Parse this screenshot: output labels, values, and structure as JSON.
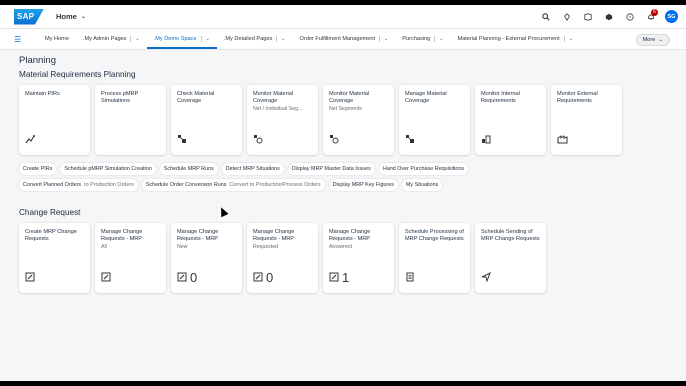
{
  "shell": {
    "logo": "SAP",
    "home_label": "Home",
    "notification_count": "6",
    "user_initials": "SG"
  },
  "tabs": [
    {
      "label": "My Home",
      "active": false
    },
    {
      "label": ".My Admin Pages",
      "active": false
    },
    {
      "label": ".My Demo Space",
      "active": true
    },
    {
      "label": ".My Detailed Pages",
      "active": false
    },
    {
      "label": "Order Fulfillment Management",
      "active": false
    },
    {
      "label": "Purchasing",
      "active": false
    },
    {
      "label": "Material Planning - External Procurement",
      "active": false
    }
  ],
  "more_label": "More",
  "page_title": "Planning",
  "mrp": {
    "title": "Material Requirements Planning",
    "tiles": [
      {
        "title": "Maintain PIRs",
        "sub": "",
        "icon": "chart-icon"
      },
      {
        "title": "Process pMRP Simulations",
        "sub": "",
        "icon": ""
      },
      {
        "title": "Check Material Coverage",
        "sub": "",
        "icon": "coverage-icon"
      },
      {
        "title": "Monitor Material Coverage",
        "sub": "Net / Individual Seg...",
        "icon": "monitor-icon"
      },
      {
        "title": "Monitor Material Coverage",
        "sub": "Net Segments",
        "icon": "monitor-icon"
      },
      {
        "title": "Manage Material Coverage",
        "sub": "",
        "icon": "coverage-icon"
      },
      {
        "title": "Monitor Internal Requirements",
        "sub": "",
        "icon": "internal-icon"
      },
      {
        "title": "Monitor External Requirements",
        "sub": "",
        "icon": "factory-icon"
      }
    ],
    "links": [
      {
        "title": "Create PIRs",
        "sub": ""
      },
      {
        "title": "Schedule pMRP Simulation Creation",
        "sub": ""
      },
      {
        "title": "Schedule MRP Runs",
        "sub": ""
      },
      {
        "title": "Detect MRP Situations",
        "sub": ""
      },
      {
        "title": "Display MRP Master Data Issues",
        "sub": ""
      },
      {
        "title": "Hand Over Purchase Requisitions",
        "sub": ""
      },
      {
        "title": "Convert Planned Orders",
        "sub": "to Production Orders"
      },
      {
        "title": "Schedule Order Conversion Runs",
        "sub": "Convert to Production/Process Orders"
      },
      {
        "title": "Display MRP Key Figures",
        "sub": ""
      },
      {
        "title": "My Situations",
        "sub": ""
      }
    ]
  },
  "change_request": {
    "title": "Change Request",
    "tiles": [
      {
        "title": "Create MRP Change Requests",
        "sub": "",
        "icon": "edit-icon",
        "number": ""
      },
      {
        "title": "Manage Change Requests - MRP",
        "sub": "All",
        "icon": "edit-icon",
        "number": ""
      },
      {
        "title": "Manage Change Requests - MRP",
        "sub": "New",
        "icon": "edit-icon",
        "number": "0"
      },
      {
        "title": "Manage Change Requests - MRP",
        "sub": "Requested",
        "icon": "edit-icon",
        "number": "0"
      },
      {
        "title": "Manage Change Requests - MRP",
        "sub": "Answered",
        "icon": "edit-icon",
        "number": "1"
      },
      {
        "title": "Schedule Processing of MRP Change Requests",
        "sub": "",
        "icon": "document-icon",
        "number": ""
      },
      {
        "title": "Schedule Sending of MRP Change Requests",
        "sub": "",
        "icon": "send-icon",
        "number": ""
      }
    ]
  }
}
